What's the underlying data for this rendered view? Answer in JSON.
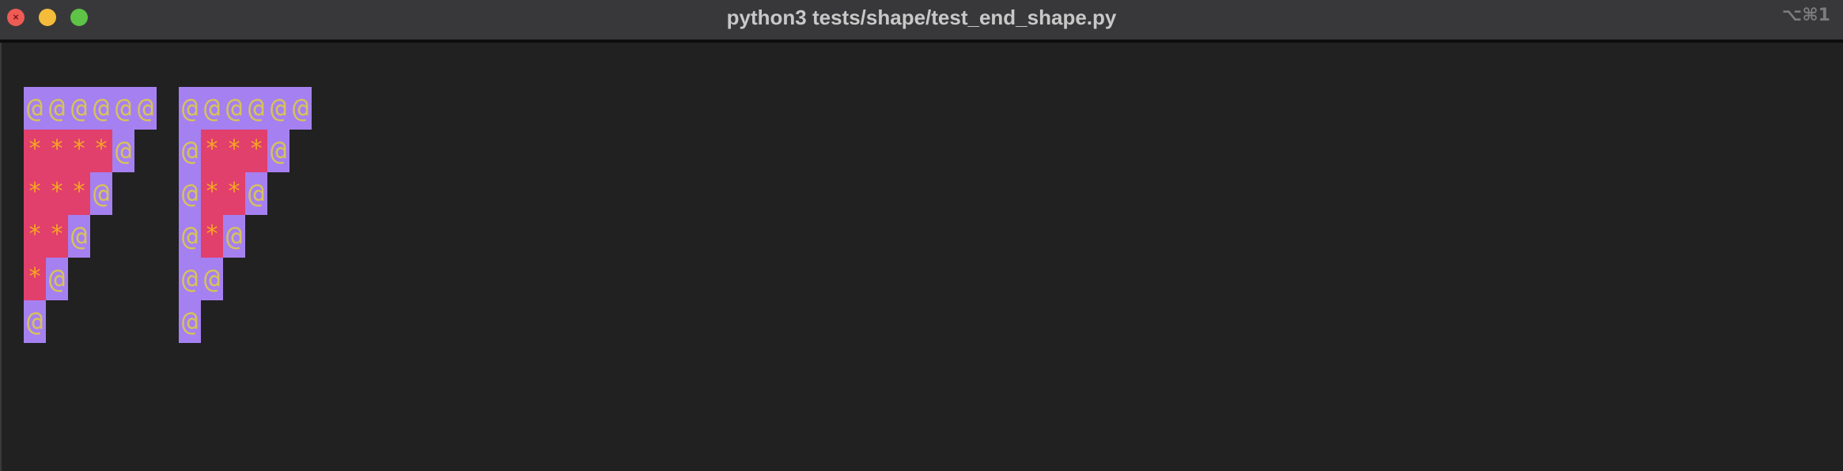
{
  "window": {
    "title": "python3 tests/shape/test_end_shape.py",
    "shortcut": "⌥⌘1",
    "close_glyph": "×"
  },
  "terminal": {
    "shapes": [
      {
        "rows": [
          "@@@@@@",
          "****@",
          "***@",
          "**@",
          "*@",
          "@"
        ]
      },
      {
        "rows": [
          "@@@@@@",
          "@***@",
          "@**@",
          "@*@",
          "@@",
          "@"
        ]
      }
    ]
  },
  "colors": {
    "at_background": "#a580f0",
    "at_text": "#d6c25b",
    "star_background": "#e13f6c",
    "star_text": "#f5a623",
    "terminal_background": "#212121",
    "titlebar_background": "#38383a"
  }
}
